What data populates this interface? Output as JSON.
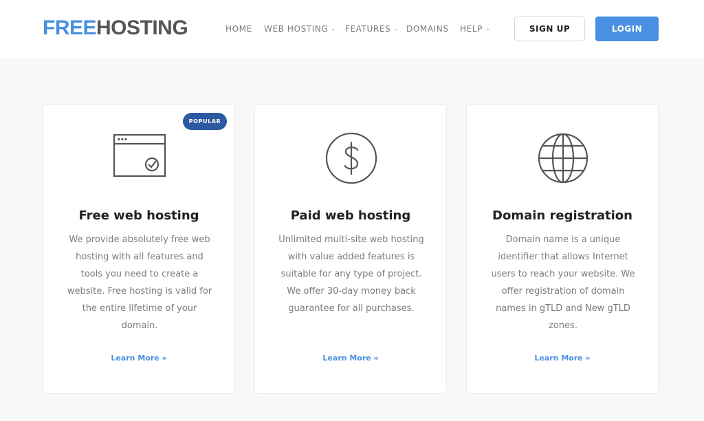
{
  "header": {
    "logo": {
      "part1": "FREE",
      "part2": "HOSTING"
    },
    "nav": [
      {
        "label": "HOME",
        "has_caret": false
      },
      {
        "label": "WEB HOSTING",
        "has_caret": true
      },
      {
        "label": "FEATURES",
        "has_caret": true
      },
      {
        "label": "DOMAINS",
        "has_caret": false
      },
      {
        "label": "HELP",
        "has_caret": true
      }
    ],
    "signup_label": "SIGN UP",
    "login_label": "LOGIN"
  },
  "cards": [
    {
      "badge": "POPULAR",
      "icon": "browser-check-icon",
      "title": "Free web hosting",
      "description": "We provide absolutely free web hosting with all features and tools you need to create a website. Free hosting is valid for the entire lifetime of your domain.",
      "link": "Learn More »"
    },
    {
      "icon": "dollar-coin-icon",
      "title": "Paid web hosting",
      "description": "Unlimited multi-site web hosting with value added features is suitable for any type of project. We offer 30-day money back guarantee for all purchases.",
      "link": "Learn More »"
    },
    {
      "icon": "globe-icon",
      "title": "Domain registration",
      "description": "Domain name is a unique identifier that allows Internet users to reach your website. We offer registration of domain names in gTLD and New gTLD zones.",
      "link": "Learn More »"
    }
  ],
  "colors": {
    "accent": "#4a90e2",
    "badge": "#2c5aa0",
    "logo_secondary": "#555555",
    "background": "#f8f8f8"
  }
}
